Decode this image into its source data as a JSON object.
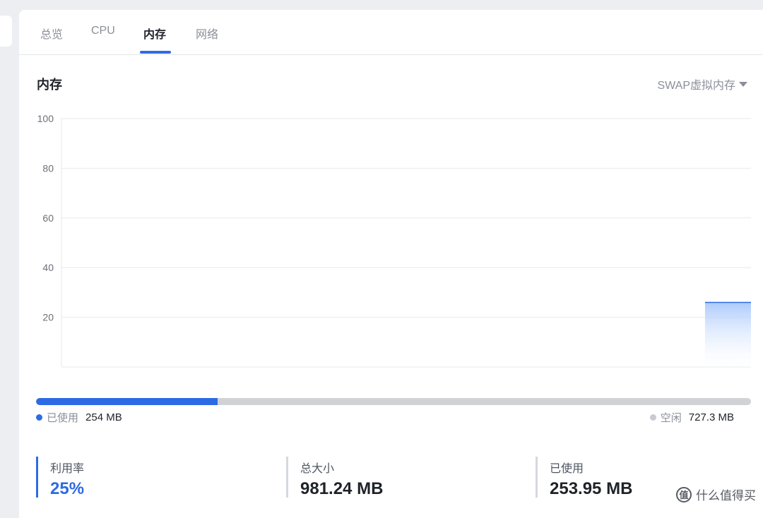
{
  "tabs": [
    {
      "label": "总览",
      "active": false
    },
    {
      "label": "CPU",
      "active": false
    },
    {
      "label": "内存",
      "active": true
    },
    {
      "label": "网络",
      "active": false
    }
  ],
  "section": {
    "title": "内存",
    "swap_label": "SWAP虚拟内存"
  },
  "chart_data": {
    "type": "area",
    "y_ticks": [
      "100",
      "80",
      "60",
      "40",
      "20"
    ],
    "ylim": [
      0,
      100
    ],
    "series": [
      {
        "values": [
          0,
          0,
          0,
          0,
          0,
          0,
          0,
          0,
          0,
          0,
          0,
          0,
          0,
          0,
          26
        ]
      }
    ],
    "grid": true,
    "colors": {
      "line": "#2d6be4",
      "fill_top": "#a9c8fb",
      "fill_bottom": "#ffffff"
    }
  },
  "usage": {
    "used_fraction": 0.254,
    "used_label": "已使用",
    "used_value": "254 MB",
    "free_label": "空闲",
    "free_value": "727.3 MB"
  },
  "stats": [
    {
      "label": "利用率",
      "value": "25%"
    },
    {
      "label": "总大小",
      "value": "981.24 MB"
    },
    {
      "label": "已使用",
      "value": "253.95 MB"
    }
  ],
  "watermark": {
    "logo_char": "值",
    "text": "什么值得买"
  },
  "colors": {
    "accent": "#2d6be4",
    "muted": "#8a8f99",
    "bar_track": "#d0d2d6",
    "free_dot": "#c8cacf"
  }
}
